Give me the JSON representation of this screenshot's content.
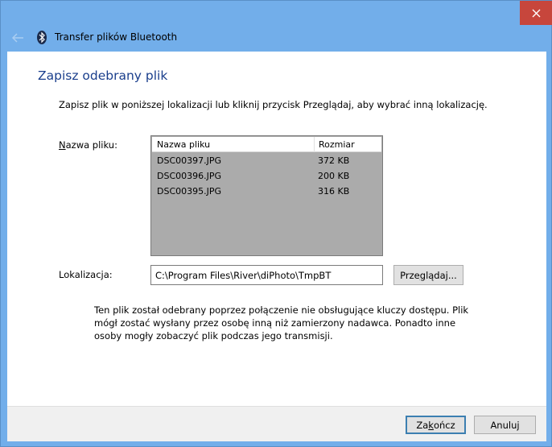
{
  "window": {
    "title": "Transfer plików Bluetooth",
    "accent_color": "#72aeea",
    "close_color": "#c7463c"
  },
  "icons": {
    "back": "back-arrow-icon",
    "bluetooth": "bluetooth-icon",
    "close": "close-icon"
  },
  "main": {
    "heading": "Zapisz odebrany plik",
    "instruction": "Zapisz plik w poniższej lokalizacji lub kliknij przycisk Przeglądaj, aby wybrać inną lokalizację.",
    "filename_label_prefix": "N",
    "filename_label_rest": "azwa pliku:",
    "file_table": {
      "columns": [
        "Nazwa pliku",
        "Rozmiar"
      ],
      "rows": [
        {
          "name": "DSC00397.JPG",
          "size": "372 KB"
        },
        {
          "name": "DSC00396.JPG",
          "size": "200 KB"
        },
        {
          "name": "DSC00395.JPG",
          "size": "316 KB"
        }
      ]
    },
    "location_label": "Lokalizacja:",
    "location_value": "C:\\Program Files\\River\\diPhoto\\TmpBT",
    "browse_label_pre": "Prze",
    "browse_label_u": "g",
    "browse_label_post": "lądaj...",
    "warning": "Ten plik został odebrany poprzez połączenie nie obsługujące kluczy dostępu. Plik mógł zostać wysłany przez osobę inną niż zamierzony nadawca. Ponadto inne osoby mogły zobaczyć plik podczas jego transmisji."
  },
  "footer": {
    "finish_label_pre": "Za",
    "finish_label_u": "k",
    "finish_label_post": "ończ",
    "cancel_label": "Anuluj"
  }
}
